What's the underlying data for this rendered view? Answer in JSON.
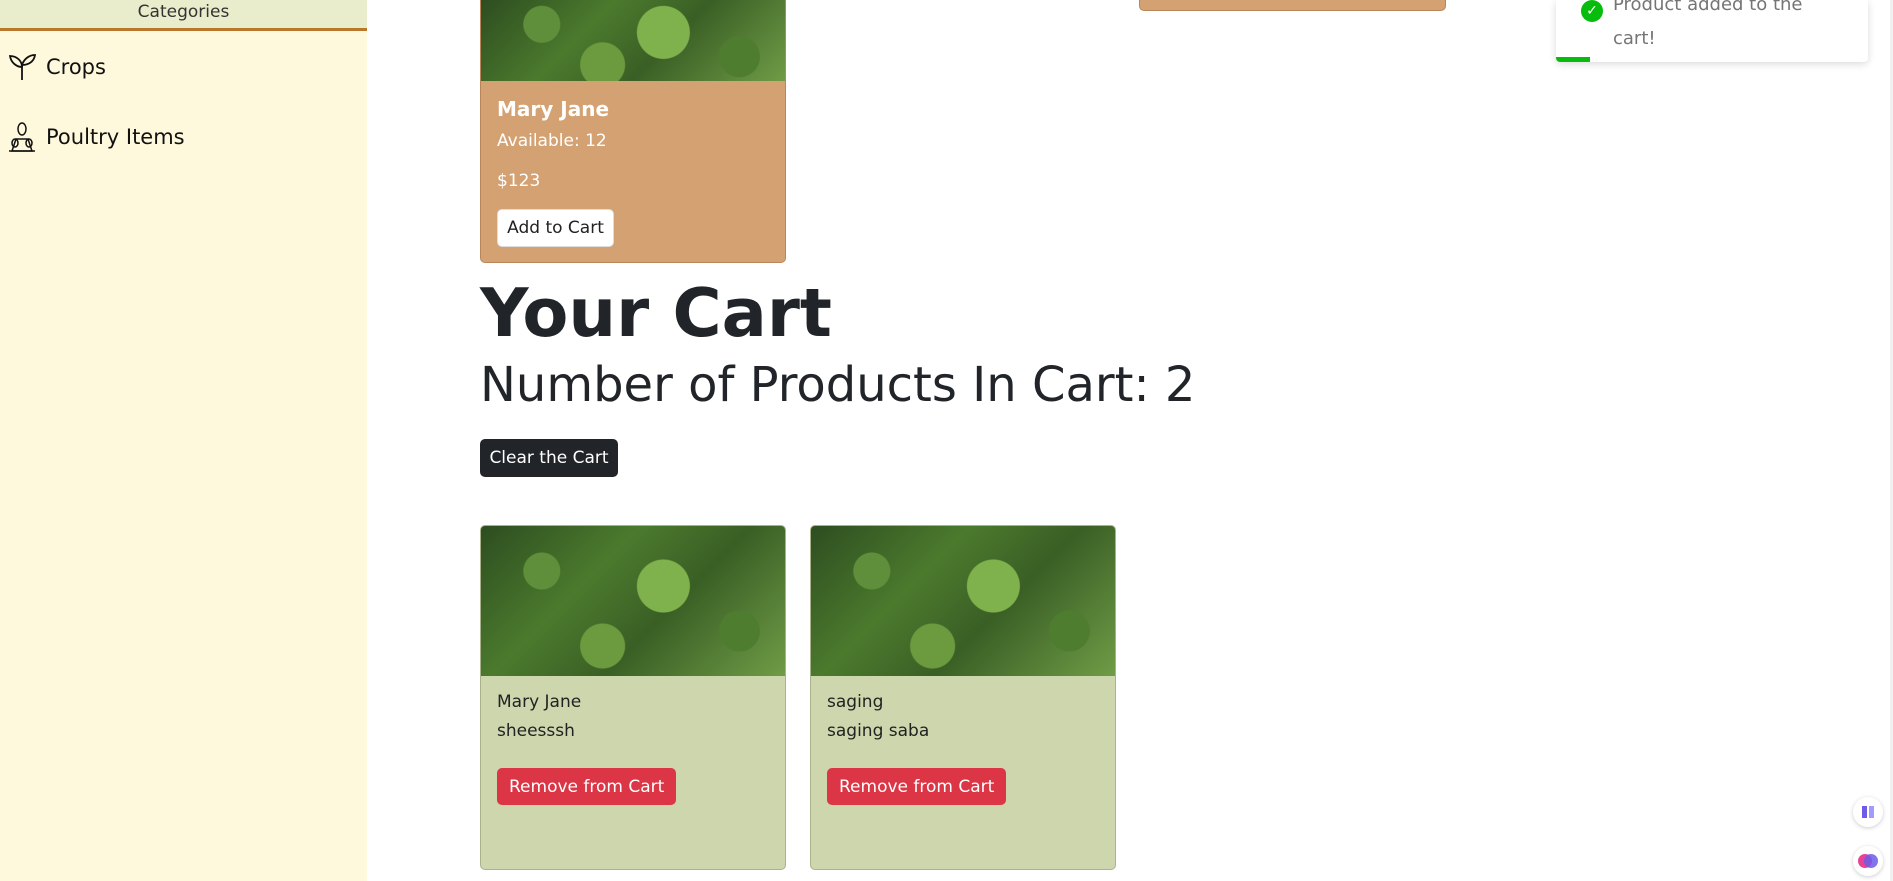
{
  "sidebar": {
    "header": "Categories",
    "items": [
      {
        "label": "Crops",
        "icon": "sprout-icon"
      },
      {
        "label": "Poultry Items",
        "icon": "poultry-icon"
      }
    ]
  },
  "top_product": {
    "name": "Mary Jane",
    "available": "Available: 12",
    "price": "$123",
    "button": "Add to Cart"
  },
  "cart": {
    "title": "Your Cart",
    "count_text": "Number of Products In Cart: 2",
    "clear_label": "Clear the Cart",
    "items": [
      {
        "name": "Mary Jane",
        "description": "sheesssh",
        "remove_label": "Remove from Cart"
      },
      {
        "name": "saging",
        "description": "saging saba",
        "remove_label": "Remove from Cart"
      }
    ]
  },
  "toast": {
    "message": "Product added to the cart!",
    "progress": 0.11,
    "color": "#07bc0c"
  },
  "colors": {
    "sidebar_bg": "#fef9dc",
    "product_card": "#d4a272",
    "cart_card": "#cdd6ad",
    "danger": "#dc3545",
    "dark_button": "#212529"
  }
}
